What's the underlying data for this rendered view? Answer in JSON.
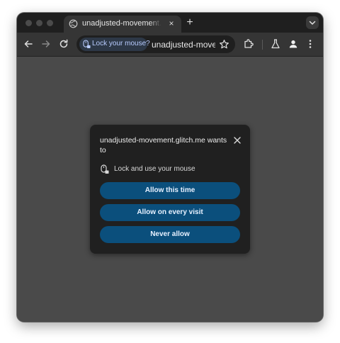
{
  "tab": {
    "title": "unadjusted-movement.glitch.me",
    "close_glyph": "×",
    "new_tab_glyph": "+"
  },
  "toolbar": {
    "permission_chip_label": "Lock your mouse?",
    "url": "unadjusted-movement.glitch.me"
  },
  "dialog": {
    "title": "unadjusted-movement.glitch.me wants to",
    "permission_label": "Lock and use your mouse",
    "buttons": [
      {
        "label": "Allow this time"
      },
      {
        "label": "Allow on every visit"
      },
      {
        "label": "Never allow"
      }
    ]
  },
  "icons": {
    "tab_favicon": "globe-icon",
    "back": "arrow-left-icon",
    "forward": "arrow-right-icon",
    "reload": "reload-icon",
    "chip": "mouse-lock-icon",
    "bookmark": "star-icon",
    "extensions": "puzzle-icon",
    "labs": "flask-icon",
    "profile": "profile-icon",
    "menu": "kebab-menu-icon",
    "tab_search": "chevron-down-icon",
    "dialog_close": "close-icon",
    "permission": "mouse-icon"
  },
  "colors": {
    "frame": "#1f1f1f",
    "toolbar": "#353535",
    "content": "#4a4a4a",
    "dialog": "#202020",
    "button": "#0b4f7c",
    "chip": "#2d3847"
  }
}
